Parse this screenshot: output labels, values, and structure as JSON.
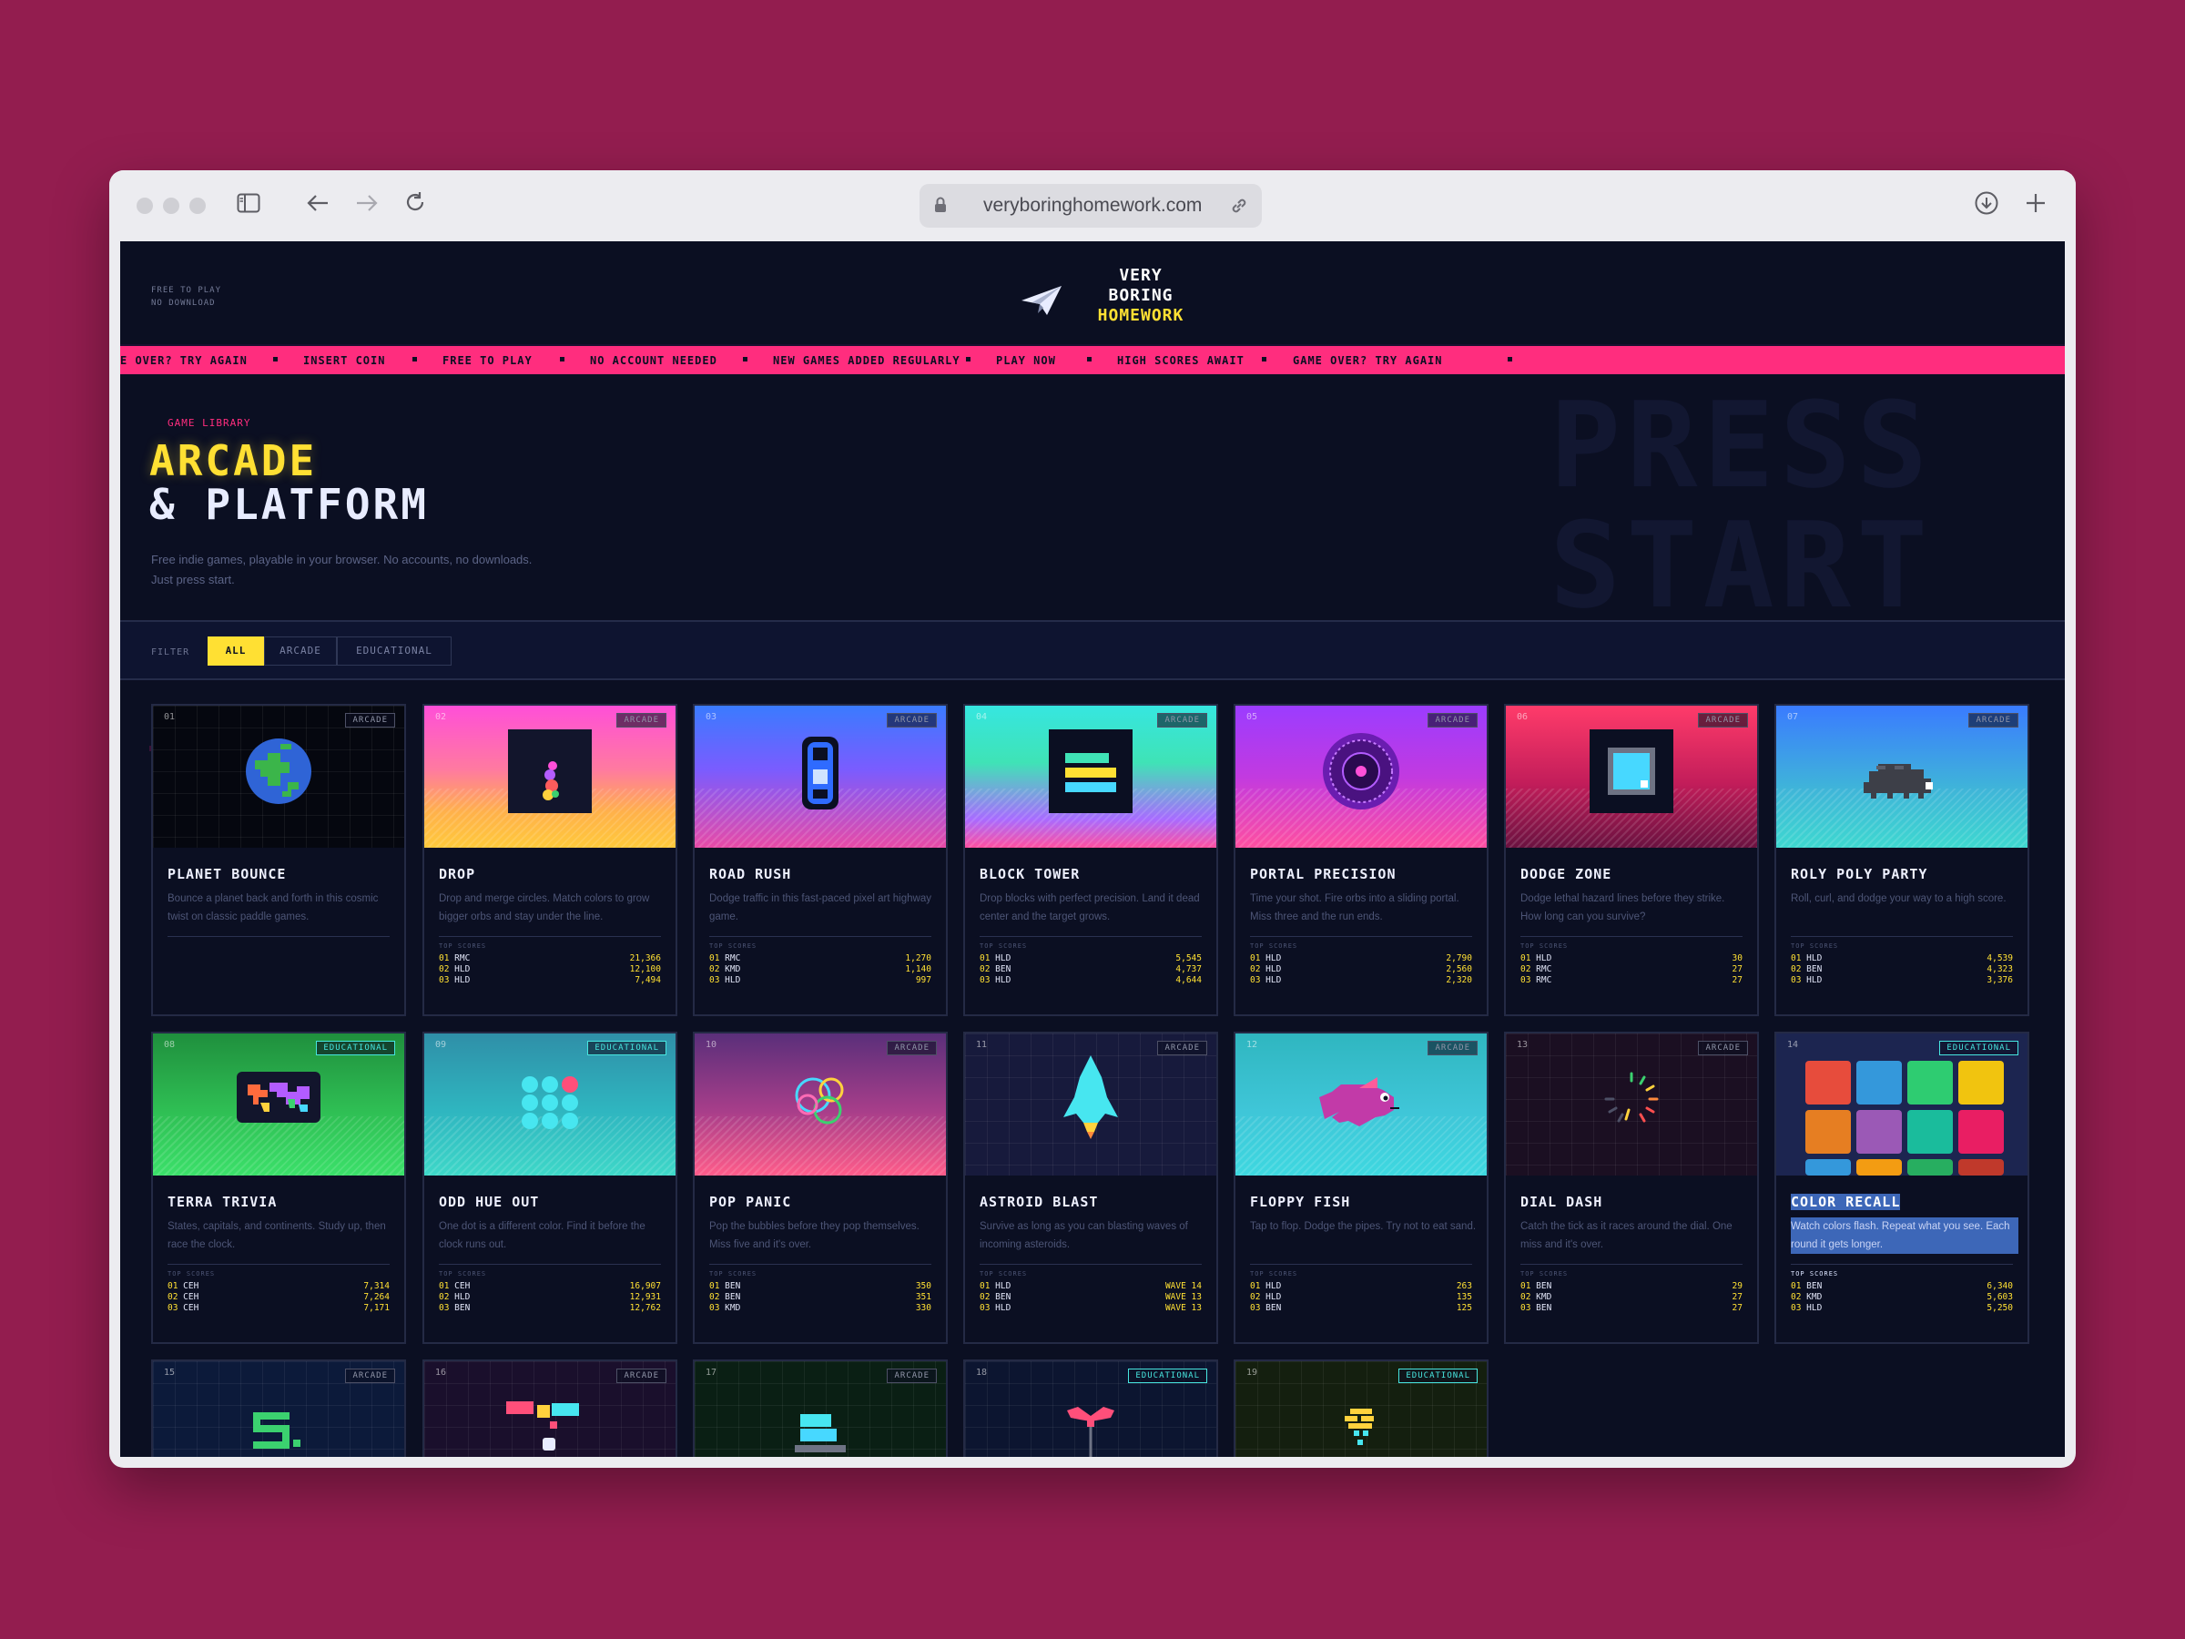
{
  "browser": {
    "url": "veryboringhomework.com"
  },
  "site": {
    "tagline": [
      "FREE TO PLAY",
      "NO DOWNLOAD"
    ],
    "logo_lines": [
      "VERY",
      "BORING",
      "HOMEWORK"
    ]
  },
  "ticker": [
    "E OVER? TRY AGAIN",
    "INSERT COIN",
    "FREE TO PLAY",
    "NO ACCOUNT NEEDED",
    "NEW GAMES ADDED REGULARLY",
    "PLAY NOW",
    "HIGH SCORES AWAIT",
    "GAME OVER? TRY AGAIN"
  ],
  "hero": {
    "eyebrow": "GAME LIBRARY",
    "title_line1": "ARCADE",
    "title_line2": "& PLATFORM",
    "description": "Free indie games, playable in your browser. No accounts, no downloads. Just press start.",
    "bg_text": "PRESS\nSTART"
  },
  "filter": {
    "label": "FILTER",
    "options": [
      "ALL",
      "ARCADE",
      "EDUCATIONAL"
    ],
    "selected": "ALL"
  },
  "top_scores_label": "TOP SCORES",
  "games": [
    {
      "num": "01",
      "badge": "ARCADE",
      "title": "PLANET BOUNCE",
      "desc": "Bounce a planet back and forth in this cosmic twist on classic paddle games.",
      "scores": []
    },
    {
      "num": "02",
      "badge": "ARCADE",
      "title": "DROP",
      "desc": "Drop and merge circles. Match colors to grow bigger orbs and stay under the line.",
      "scores": [
        [
          "01",
          "RMC",
          "21,366"
        ],
        [
          "02",
          "HLD",
          "12,100"
        ],
        [
          "03",
          "HLD",
          "7,494"
        ]
      ]
    },
    {
      "num": "03",
      "badge": "ARCADE",
      "title": "ROAD RUSH",
      "desc": "Dodge traffic in this fast-paced pixel art highway game.",
      "scores": [
        [
          "01",
          "RMC",
          "1,270"
        ],
        [
          "02",
          "KMD",
          "1,140"
        ],
        [
          "03",
          "HLD",
          "997"
        ]
      ]
    },
    {
      "num": "04",
      "badge": "ARCADE",
      "title": "BLOCK TOWER",
      "desc": "Drop blocks with perfect precision. Land it dead center and the target grows.",
      "scores": [
        [
          "01",
          "HLD",
          "5,545"
        ],
        [
          "02",
          "BEN",
          "4,737"
        ],
        [
          "03",
          "HLD",
          "4,644"
        ]
      ]
    },
    {
      "num": "05",
      "badge": "ARCADE",
      "title": "PORTAL PRECISION",
      "desc": "Time your shot. Fire orbs into a sliding portal. Miss three and the run ends.",
      "scores": [
        [
          "01",
          "HLD",
          "2,790"
        ],
        [
          "02",
          "HLD",
          "2,560"
        ],
        [
          "03",
          "HLD",
          "2,320"
        ]
      ]
    },
    {
      "num": "06",
      "badge": "ARCADE",
      "title": "DODGE ZONE",
      "desc": "Dodge lethal hazard lines before they strike. How long can you survive?",
      "scores": [
        [
          "01",
          "HLD",
          "30"
        ],
        [
          "02",
          "RMC",
          "27"
        ],
        [
          "03",
          "RMC",
          "27"
        ]
      ]
    },
    {
      "num": "07",
      "badge": "ARCADE",
      "title": "ROLY POLY PARTY",
      "desc": "Roll, curl, and dodge your way to a high score.",
      "scores": [
        [
          "01",
          "HLD",
          "4,539"
        ],
        [
          "02",
          "BEN",
          "4,323"
        ],
        [
          "03",
          "HLD",
          "3,376"
        ]
      ]
    },
    {
      "num": "08",
      "badge": "EDUCATIONAL",
      "title": "TERRA TRIVIA",
      "desc": "States, capitals, and continents. Study up, then race the clock.",
      "scores": [
        [
          "01",
          "CEH",
          "7,314"
        ],
        [
          "02",
          "CEH",
          "7,264"
        ],
        [
          "03",
          "CEH",
          "7,171"
        ]
      ]
    },
    {
      "num": "09",
      "badge": "EDUCATIONAL",
      "title": "ODD HUE OUT",
      "desc": "One dot is a different color. Find it before the clock runs out.",
      "scores": [
        [
          "01",
          "CEH",
          "16,907"
        ],
        [
          "02",
          "HLD",
          "12,931"
        ],
        [
          "03",
          "BEN",
          "12,762"
        ]
      ]
    },
    {
      "num": "10",
      "badge": "ARCADE",
      "title": "POP PANIC",
      "desc": "Pop the bubbles before they pop themselves. Miss five and it's over.",
      "scores": [
        [
          "01",
          "BEN",
          "350"
        ],
        [
          "02",
          "BEN",
          "351"
        ],
        [
          "03",
          "KMD",
          "330"
        ]
      ]
    },
    {
      "num": "11",
      "badge": "ARCADE",
      "title": "ASTROID BLAST",
      "desc": "Survive as long as you can blasting waves of incoming asteroids.",
      "scores": [
        [
          "01",
          "HLD",
          "WAVE 14"
        ],
        [
          "02",
          "BEN",
          "WAVE 13"
        ],
        [
          "03",
          "HLD",
          "WAVE 13"
        ]
      ]
    },
    {
      "num": "12",
      "badge": "ARCADE",
      "title": "FLOPPY FISH",
      "desc": "Tap to flop. Dodge the pipes. Try not to eat sand.",
      "scores": [
        [
          "01",
          "HLD",
          "263"
        ],
        [
          "02",
          "HLD",
          "135"
        ],
        [
          "03",
          "BEN",
          "125"
        ]
      ]
    },
    {
      "num": "13",
      "badge": "ARCADE",
      "title": "DIAL DASH",
      "desc": "Catch the tick as it races around the dial. One miss and it's over.",
      "scores": [
        [
          "01",
          "BEN",
          "29"
        ],
        [
          "02",
          "KMD",
          "27"
        ],
        [
          "03",
          "BEN",
          "27"
        ]
      ]
    },
    {
      "num": "14",
      "badge": "EDUCATIONAL",
      "title": "COLOR RECALL",
      "desc": "Watch colors flash. Repeat what you see. Each round it gets longer.",
      "scores": [
        [
          "01",
          "BEN",
          "6,340"
        ],
        [
          "02",
          "KMD",
          "5,603"
        ],
        [
          "03",
          "HLD",
          "5,250"
        ]
      ]
    },
    {
      "num": "15",
      "badge": "ARCADE",
      "title": "",
      "desc": "",
      "scores": []
    },
    {
      "num": "16",
      "badge": "ARCADE",
      "title": "",
      "desc": "",
      "scores": []
    },
    {
      "num": "17",
      "badge": "ARCADE",
      "title": "",
      "desc": "",
      "scores": []
    },
    {
      "num": "18",
      "badge": "EDUCATIONAL",
      "title": "",
      "desc": "",
      "scores": []
    },
    {
      "num": "19",
      "badge": "EDUCATIONAL",
      "title": "",
      "desc": "",
      "scores": []
    }
  ],
  "colors": {
    "page_bg": "#931d4f",
    "site_bg": "#0b0f22",
    "accent_yellow": "#ffe033",
    "accent_pink": "#ff2d7e",
    "accent_cyan": "#47e6e0"
  }
}
